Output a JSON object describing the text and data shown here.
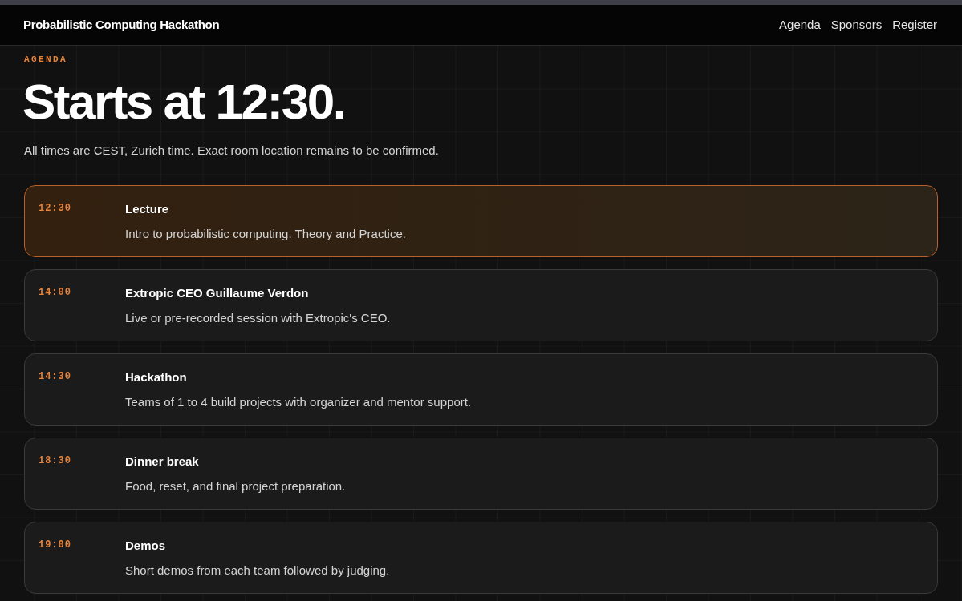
{
  "header": {
    "title": "Probabilistic Computing Hackathon",
    "nav": [
      {
        "label": "Agenda"
      },
      {
        "label": "Sponsors"
      },
      {
        "label": "Register"
      }
    ]
  },
  "agenda": {
    "eyebrow": "AGENDA",
    "heading": "Starts at 12:30.",
    "subtitle": "All times are CEST, Zurich time. Exact room location remains to be confirmed."
  },
  "sessions": [
    {
      "time": "12:30",
      "title": "Lecture",
      "description": "Intro to probabilistic computing. Theory and Practice.",
      "selected": true
    },
    {
      "time": "14:00",
      "title": "Extropic CEO Guillaume Verdon",
      "description": "Live or pre-recorded session with Extropic's CEO.",
      "selected": false
    },
    {
      "time": "14:30",
      "title": "Hackathon",
      "description": "Teams of 1 to 4 build projects with organizer and mentor support.",
      "selected": false
    },
    {
      "time": "18:30",
      "title": "Dinner break",
      "description": "Food, reset, and final project preparation.",
      "selected": false
    },
    {
      "time": "19:00",
      "title": "Demos",
      "description": "Short demos from each team followed by judging.",
      "selected": false
    }
  ]
}
